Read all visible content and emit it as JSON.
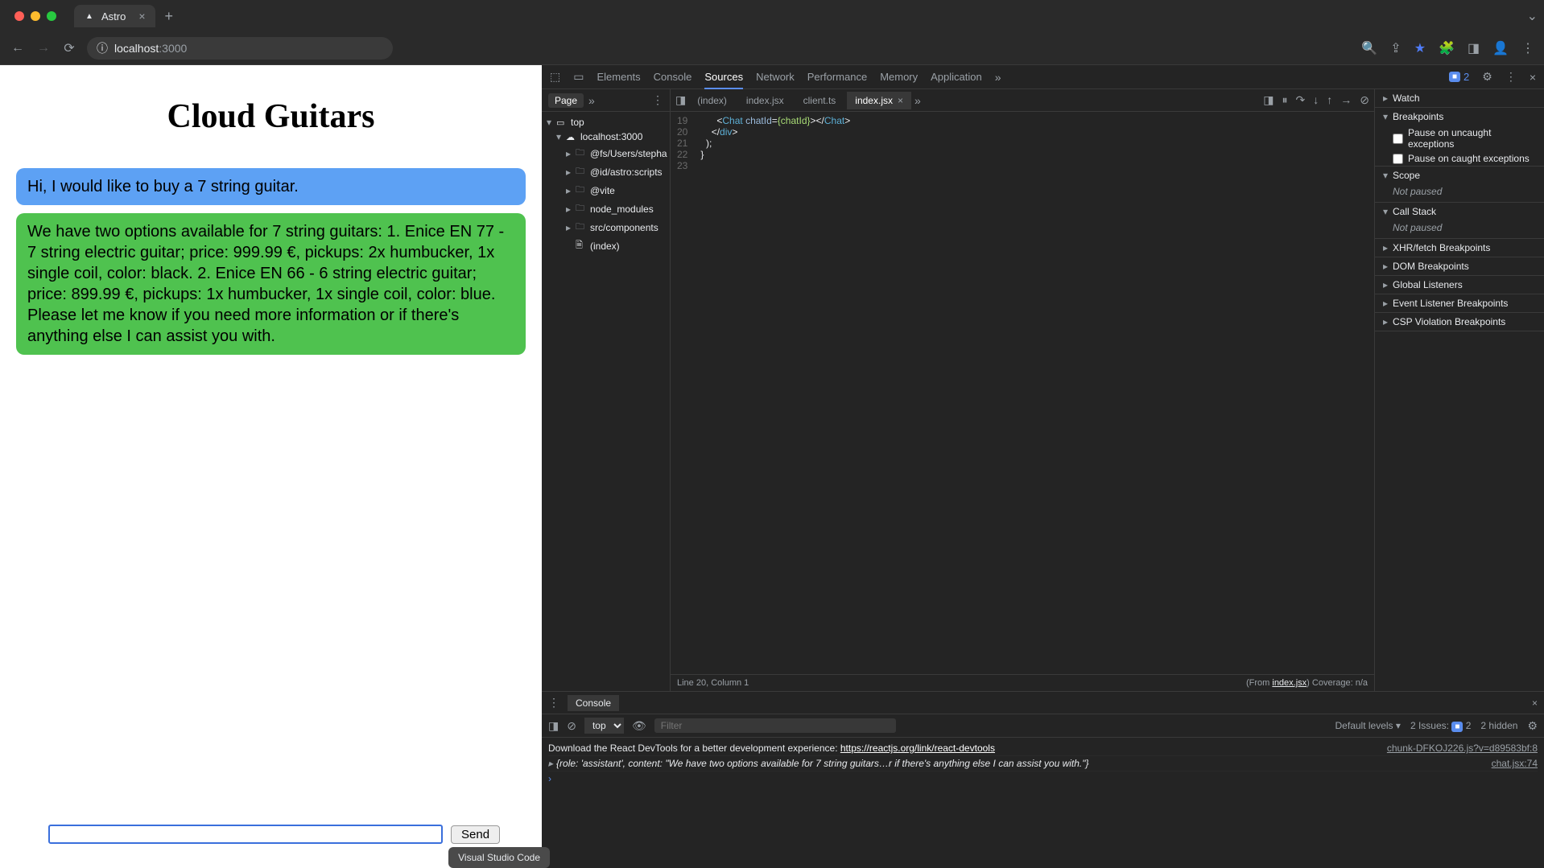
{
  "browser": {
    "tab_title": "Astro",
    "url_host": "localhost",
    "url_port": ":3000"
  },
  "page": {
    "title": "Cloud Guitars",
    "messages": [
      {
        "role": "user",
        "text": "Hi, I would like to buy a 7 string guitar."
      },
      {
        "role": "assistant",
        "text": "We have two options available for 7 string guitars: 1. Enice EN 77 - 7 string electric guitar; price: 999.99 €, pickups: 2x humbucker, 1x single coil, color: black. 2. Enice EN 66 - 6 string electric guitar; price: 899.99 €, pickups: 1x humbucker, 1x single coil, color: blue. Please let me know if you need more information or if there's anything else I can assist you with."
      }
    ],
    "send_label": "Send",
    "tooltip": "Visual Studio Code"
  },
  "devtools": {
    "tabs": [
      "Elements",
      "Console",
      "Sources",
      "Network",
      "Performance",
      "Memory",
      "Application"
    ],
    "active_tab": "Sources",
    "issues_count": "2",
    "filetree": {
      "tab": "Page",
      "root": "top",
      "host": "localhost:3000",
      "folders": [
        "@fs/Users/stepha",
        "@id/astro:scripts",
        "@vite",
        "node_modules",
        "src/components"
      ],
      "file": "(index)"
    },
    "editor": {
      "tabs": [
        "(index)",
        "index.jsx",
        "client.ts",
        "index.jsx"
      ],
      "active_tab_index": 3,
      "lines_start": 19,
      "lines": [
        "      <Chat chatId={chatId}></Chat>",
        "    </div>",
        "  );",
        "}",
        ""
      ],
      "status_left": "Line 20, Column 1",
      "status_from": "(From ",
      "status_file": "index.jsx",
      "status_coverage": ") Coverage: n/a"
    },
    "watch": {
      "sections": {
        "watch": "Watch",
        "breakpoints": "Breakpoints",
        "pause_uncaught": "Pause on uncaught exceptions",
        "pause_caught": "Pause on caught exceptions",
        "scope": "Scope",
        "scope_body": "Not paused",
        "callstack": "Call Stack",
        "callstack_body": "Not paused",
        "xhr": "XHR/fetch Breakpoints",
        "dom": "DOM Breakpoints",
        "global": "Global Listeners",
        "event": "Event Listener Breakpoints",
        "csp": "CSP Violation Breakpoints"
      }
    },
    "console": {
      "tab": "Console",
      "context": "top",
      "filter_placeholder": "Filter",
      "levels": "Default levels",
      "issues_label": "2 Issues:",
      "issues_badge": "2",
      "hidden": "2 hidden",
      "entries": {
        "src1": "chunk-DFKOJ226.js?v=d89583bf:8",
        "msg1a": "Download the React DevTools for a better development experience: ",
        "msg1b": "https://reactjs.org/link/react-devtools",
        "src2": "chat.jsx:74",
        "obj2": "{role: 'assistant', content: \"We have two options available for 7 string guitars…r if there's anything else I can assist you with.\"}"
      }
    }
  }
}
